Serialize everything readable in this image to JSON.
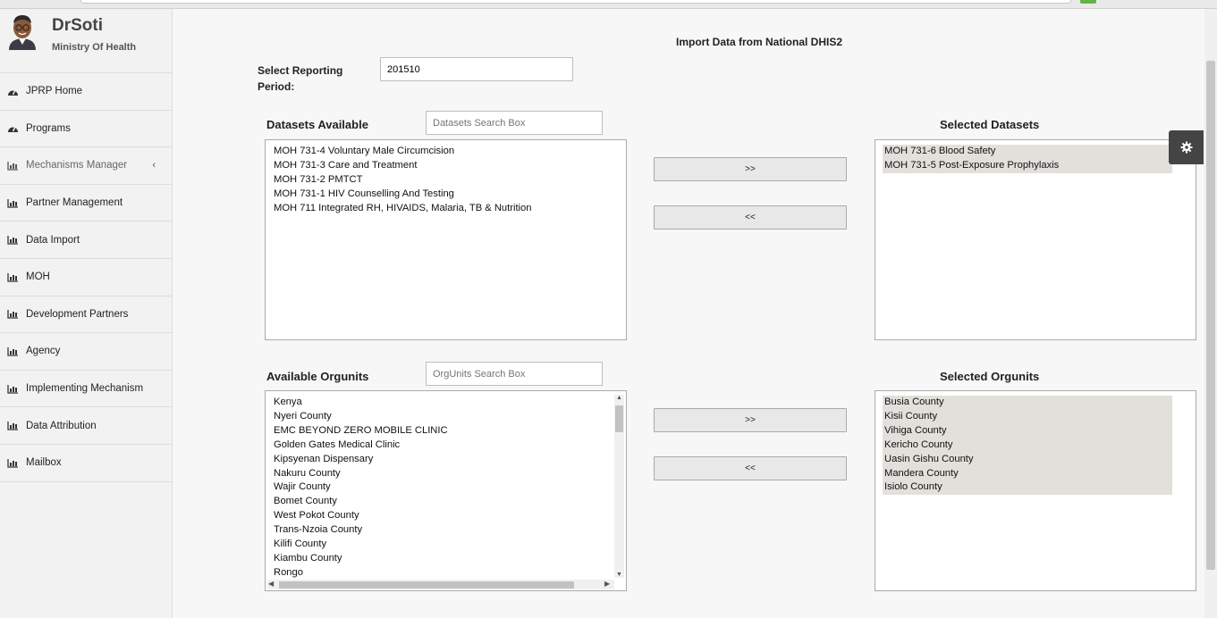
{
  "user": {
    "name": "DrSoti",
    "org": "Ministry Of Health"
  },
  "sidebar": {
    "items": [
      {
        "label": "JPRP Home",
        "icon": "dashboard-icon"
      },
      {
        "label": "Programs",
        "icon": "dashboard-icon"
      },
      {
        "label": "Mechanisms Manager",
        "icon": "bar-chart-icon"
      },
      {
        "label": "Partner Management",
        "icon": "bar-chart-icon"
      },
      {
        "label": "Data Import",
        "icon": "bar-chart-icon"
      },
      {
        "label": "MOH",
        "icon": "bar-chart-icon"
      },
      {
        "label": "Development Partners",
        "icon": "bar-chart-icon"
      },
      {
        "label": "Agency",
        "icon": "bar-chart-icon"
      },
      {
        "label": "Implementing Mechanism",
        "icon": "bar-chart-icon"
      },
      {
        "label": "Data Attribution",
        "icon": "bar-chart-icon"
      },
      {
        "label": "Mailbox",
        "icon": "bar-chart-icon"
      }
    ]
  },
  "page": {
    "title": "Import Data from National DHIS2",
    "period_label": "Select Reporting Period:",
    "period_value": "201510"
  },
  "datasets": {
    "available_label": "Datasets Available",
    "search_placeholder": "Datasets Search Box",
    "available": [
      "MOH 731-4 Voluntary Male Circumcision",
      "MOH 731-3 Care and Treatment",
      "MOH 731-2 PMTCT",
      "MOH 731-1 HIV Counselling And Testing",
      "MOH 711 Integrated RH, HIVAIDS, Malaria, TB & Nutrition"
    ],
    "selected_label": "Selected Datasets",
    "selected": [
      "MOH 731-6 Blood Safety",
      "MOH 731-5 Post-Exposure Prophylaxis"
    ],
    "add_label": ">>",
    "remove_label": "<<"
  },
  "orgunits": {
    "available_label": "Available Orgunits",
    "search_placeholder": "OrgUnits Search Box",
    "available": [
      "Kenya",
      "Nyeri County",
      "EMC BEYOND ZERO MOBILE CLINIC",
      "Golden Gates Medical Clinic",
      "Kipsyenan Dispensary",
      "Nakuru County",
      "Wajir County",
      "Bomet County",
      "West Pokot County",
      "Trans-Nzoia County",
      "Kilifi County",
      "Kiambu County",
      "Rongo"
    ],
    "selected_label": "Selected Orgunits",
    "selected": [
      "Busia County",
      "Kisii County",
      "Vihiga County",
      "Kericho County",
      "Uasin Gishu County",
      "Mandera County",
      "Isiolo County"
    ],
    "add_label": ">>",
    "remove_label": "<<"
  }
}
